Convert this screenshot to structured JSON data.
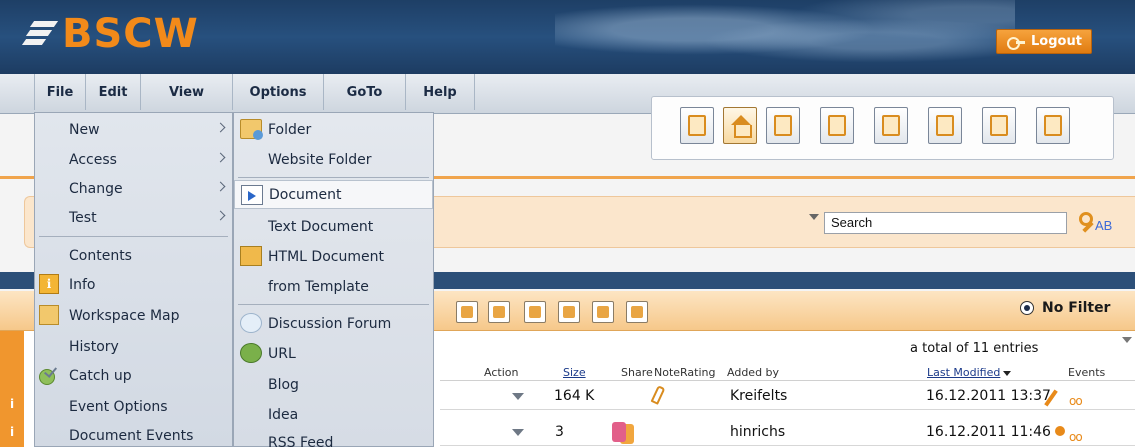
{
  "header": {
    "logo_text": "BSCW",
    "logout_label": "Logout"
  },
  "menubar": {
    "items": [
      "File",
      "Edit",
      "View",
      "Options",
      "GoTo",
      "Help"
    ]
  },
  "file_menu": {
    "items": [
      {
        "label": "New",
        "submenu": true
      },
      {
        "label": "Access",
        "submenu": true
      },
      {
        "label": "Change",
        "submenu": true
      },
      {
        "label": "Test",
        "submenu": true
      },
      {
        "label": "Contents"
      },
      {
        "label": "Info",
        "icon": "info-icon"
      },
      {
        "label": "Workspace Map",
        "icon": "workspace-map-icon"
      },
      {
        "label": "History"
      },
      {
        "label": "Catch up",
        "icon": "catch-up-icon"
      },
      {
        "label": "Event Options"
      },
      {
        "label": "Document Events"
      }
    ]
  },
  "new_menu": {
    "items": [
      {
        "label": "Folder",
        "icon": "folder-icon"
      },
      {
        "label": "Website Folder"
      },
      {
        "label": "Document",
        "icon": "document-icon",
        "highlighted": true
      },
      {
        "label": "Text Document"
      },
      {
        "label": "HTML Document",
        "icon": "html-document-icon"
      },
      {
        "label": "from Template"
      },
      {
        "label": "Discussion Forum",
        "icon": "discussion-forum-icon"
      },
      {
        "label": "URL",
        "icon": "url-icon"
      },
      {
        "label": "Blog"
      },
      {
        "label": "Idea"
      },
      {
        "label": "RSS Feed"
      }
    ]
  },
  "search": {
    "value": "Search"
  },
  "filter": {
    "label": "No Filter"
  },
  "table": {
    "total": "a total of 11 entries",
    "headers": {
      "action": "Action",
      "size": "Size",
      "share": "Share",
      "note": "Note",
      "rating": "Rating",
      "added_by": "Added by",
      "last_modified": "Last Modified",
      "events": "Events"
    },
    "rows": [
      {
        "size": "164 K",
        "added_by": "Kreifelts",
        "last_modified": "16.12.2011 13:37"
      },
      {
        "size": "3",
        "added_by": "hinrichs",
        "last_modified": "16.12.2011 11:46"
      }
    ]
  },
  "colors": {
    "accent": "#f0962e",
    "navy": "#27507e"
  }
}
